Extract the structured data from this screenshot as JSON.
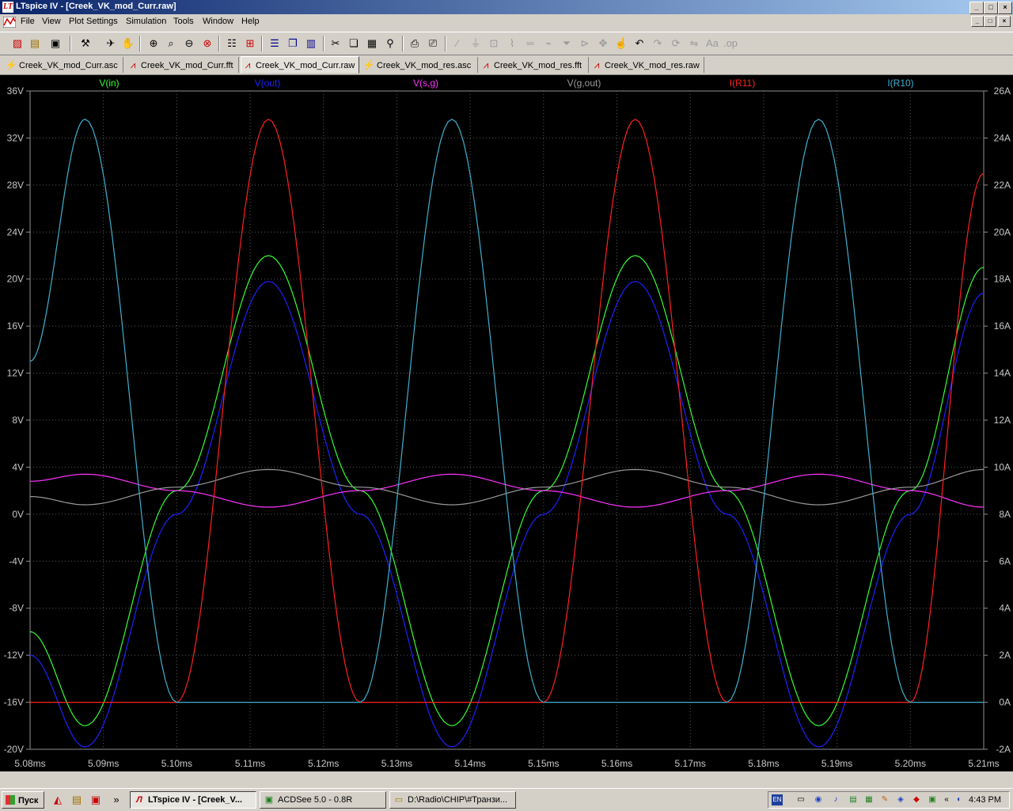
{
  "window": {
    "title": "LTspice IV - [Creek_VK_mod_Curr.raw]",
    "icon_label": "LT",
    "minimize": "_",
    "maximize": "□",
    "close": "×"
  },
  "menu": [
    "File",
    "View",
    "Plot Settings",
    "Simulation",
    "Tools",
    "Window",
    "Help"
  ],
  "toolbar": {
    "icons": [
      "new-schematic-icon",
      "open-icon",
      "save-icon",
      "control-panel-icon",
      "run-icon",
      "halt-icon",
      "zoom-in-icon",
      "zoom-area-icon",
      "zoom-out-icon",
      "zoom-cancel-icon",
      "autoscale-icon",
      "fit-icon",
      "tile-horizontal-icon",
      "cascade-icon",
      "tile-vertical-icon",
      "cut-icon",
      "copy-icon",
      "paste-icon",
      "find-icon",
      "print-preview-icon",
      "print-icon",
      "wire-icon",
      "ground-icon",
      "label-icon",
      "resistor-icon",
      "capacitor-icon",
      "inductor-icon",
      "diode-icon",
      "component-icon",
      "move-icon",
      "drag-icon",
      "undo-icon",
      "redo-icon",
      "rotate-icon",
      "mirror-icon",
      "text-icon",
      "spice-directive-icon"
    ]
  },
  "tabs": [
    {
      "label": "Creek_VK_mod_Curr.asc",
      "icon": "schematic-icon",
      "active": false
    },
    {
      "label": "Creek_VK_mod_Curr.fft",
      "icon": "waveform-icon",
      "active": false
    },
    {
      "label": "Creek_VK_mod_Curr.raw",
      "icon": "waveform-icon",
      "active": true
    },
    {
      "label": "Creek_VK_mod_res.asc",
      "icon": "schematic-icon",
      "active": false
    },
    {
      "label": "Creek_VK_mod_res.fft",
      "icon": "waveform-icon",
      "active": false
    },
    {
      "label": "Creek_VK_mod_res.raw",
      "icon": "waveform-icon",
      "active": false
    }
  ],
  "chart_data": {
    "type": "line",
    "title": "",
    "xlabel": "",
    "ylabel": "",
    "x_ticks": [
      "5.08ms",
      "5.09ms",
      "5.10ms",
      "5.11ms",
      "5.12ms",
      "5.13ms",
      "5.14ms",
      "5.15ms",
      "5.16ms",
      "5.17ms",
      "5.18ms",
      "5.19ms",
      "5.20ms",
      "5.21ms"
    ],
    "xlim_ms": [
      5.08,
      5.21
    ],
    "y_left_ticks": [
      "36V",
      "32V",
      "28V",
      "24V",
      "20V",
      "16V",
      "12V",
      "8V",
      "4V",
      "0V",
      "-4V",
      "-8V",
      "-12V",
      "-16V",
      "-20V"
    ],
    "ylim_left_V": [
      -20,
      36
    ],
    "y_right_ticks": [
      "26A",
      "24A",
      "22A",
      "20A",
      "18A",
      "16A",
      "14A",
      "12A",
      "10A",
      "8A",
      "6A",
      "4A",
      "2A",
      "0A",
      "-2A"
    ],
    "ylim_right_A": [
      -2,
      26
    ],
    "grid": true,
    "legend_placement": "top",
    "background": "#000000",
    "series": [
      {
        "name": "V(in)",
        "axis": "left",
        "color": "#33ff33",
        "x_ms": [
          5.08,
          5.0875,
          5.1,
          5.1125,
          5.125,
          5.1375,
          5.15,
          5.1625,
          5.175,
          5.1875,
          5.2,
          5.21
        ],
        "values": [
          -10,
          -18,
          2,
          22,
          2,
          -18,
          2,
          22,
          2,
          -18,
          2,
          21
        ]
      },
      {
        "name": "V(out)",
        "axis": "left",
        "color": "#2020ff",
        "x_ms": [
          5.08,
          5.0875,
          5.1,
          5.1125,
          5.125,
          5.1375,
          5.15,
          5.1625,
          5.175,
          5.1875,
          5.2,
          5.21
        ],
        "values": [
          -12,
          -19.8,
          0,
          19.8,
          0,
          -19.8,
          0,
          19.8,
          0,
          -19.8,
          0,
          18.8
        ]
      },
      {
        "name": "V(s,g)",
        "axis": "left",
        "color": "#ff33ff",
        "x_ms": [
          5.08,
          5.0875,
          5.1,
          5.1125,
          5.125,
          5.1375,
          5.15,
          5.1625,
          5.175,
          5.1875,
          5.2,
          5.21
        ],
        "values": [
          2.8,
          3.4,
          2.0,
          0.6,
          2.0,
          3.4,
          2.0,
          0.6,
          2.0,
          3.4,
          2.0,
          0.6
        ]
      },
      {
        "name": "V(g,out)",
        "axis": "left",
        "color": "#9a9a9a",
        "x_ms": [
          5.08,
          5.0875,
          5.1,
          5.1125,
          5.125,
          5.1375,
          5.15,
          5.1625,
          5.175,
          5.1875,
          5.2,
          5.21
        ],
        "values": [
          1.5,
          0.8,
          2.3,
          3.8,
          2.3,
          0.8,
          2.3,
          3.8,
          2.3,
          0.8,
          2.3,
          3.8
        ]
      },
      {
        "name": "I(R11)",
        "axis": "right",
        "color": "#ff2020",
        "x_ms": [
          5.08,
          5.1,
          5.1125,
          5.125,
          5.15,
          5.1625,
          5.175,
          5.2,
          5.21
        ],
        "values": [
          0,
          0,
          24.8,
          0,
          0,
          24.8,
          0,
          0,
          22.5
        ]
      },
      {
        "name": "I(R10)",
        "axis": "right",
        "color": "#40b0d0",
        "x_ms": [
          5.08,
          5.0875,
          5.1,
          5.125,
          5.1375,
          5.15,
          5.175,
          5.1875,
          5.2,
          5.21
        ],
        "values": [
          14.5,
          24.8,
          0,
          0,
          24.8,
          0,
          0,
          24.8,
          0,
          0
        ]
      }
    ]
  },
  "taskbar": {
    "start": "Пуск",
    "quicklaunch_more": "»",
    "buttons": [
      {
        "label": "LTspice IV - [Creek_V...",
        "icon": "ltspice-icon",
        "active": true
      },
      {
        "label": "ACDSee 5.0 - 0.8R",
        "icon": "acdsee-icon",
        "active": false
      },
      {
        "label": "D:\\Radio\\CHIP\\#Транзи...",
        "icon": "folder-icon",
        "active": false
      }
    ],
    "lang": "EN",
    "tray_more": "«",
    "clock": "4:43 PM"
  }
}
